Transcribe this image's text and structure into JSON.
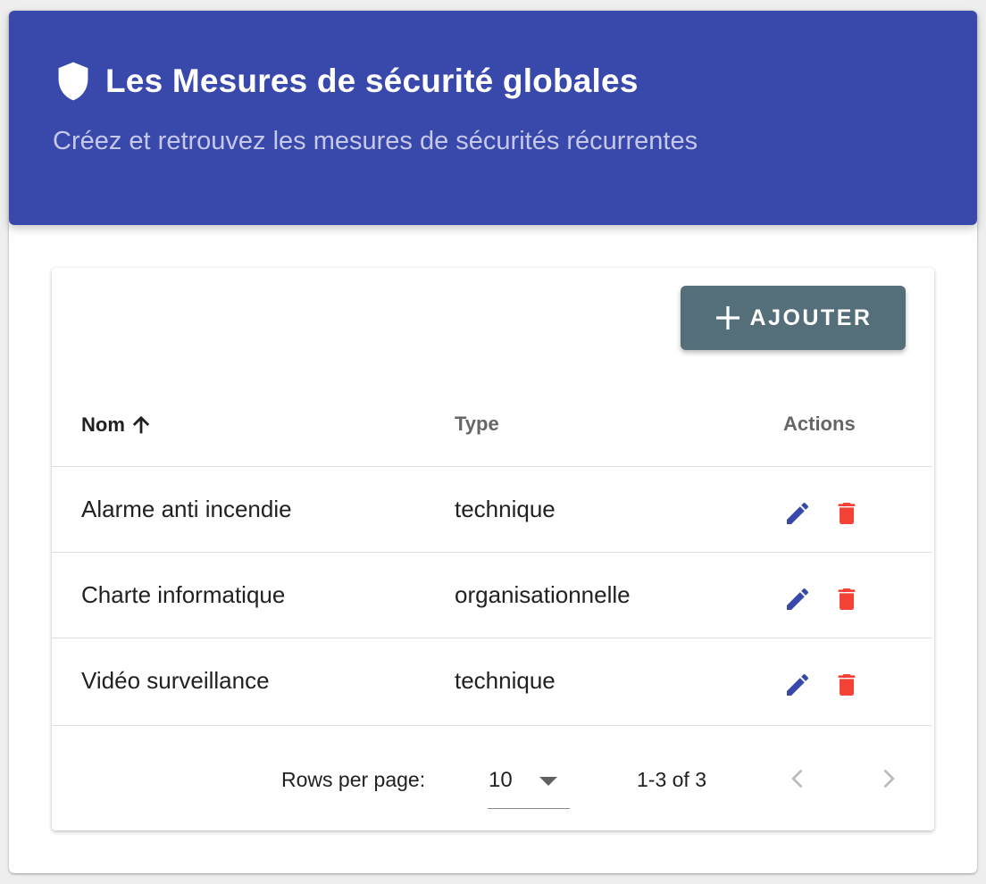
{
  "header": {
    "title": "Les Mesures de sécurité globales",
    "subtitle": "Créez et retrouvez les mesures de sécurités récurrentes",
    "icon": "shield-icon",
    "background_color": "#3949ab"
  },
  "toolbar": {
    "add_label": "AJOUTER",
    "add_icon": "plus-icon",
    "button_color": "#546e7a"
  },
  "table": {
    "columns": [
      {
        "label": "Nom",
        "sort": "ascending",
        "sort_icon": "arrow-up-icon"
      },
      {
        "label": "Type"
      },
      {
        "label": "Actions"
      }
    ],
    "rows": [
      {
        "nom": "Alarme anti incendie",
        "type": "technique"
      },
      {
        "nom": "Charte informatique",
        "type": "organisationnelle"
      },
      {
        "nom": "Vidéo surveillance",
        "type": "technique"
      }
    ],
    "action_icons": {
      "edit": "pencil-icon",
      "delete": "trash-icon"
    },
    "colors": {
      "edit": "#3949ab",
      "delete": "#f44336"
    }
  },
  "pagination": {
    "rows_per_page_label": "Rows per page:",
    "rows_per_page_value": "10",
    "range_label": "1-3 of 3",
    "prev_icon": "chevron-left-icon",
    "next_icon": "chevron-right-icon"
  }
}
